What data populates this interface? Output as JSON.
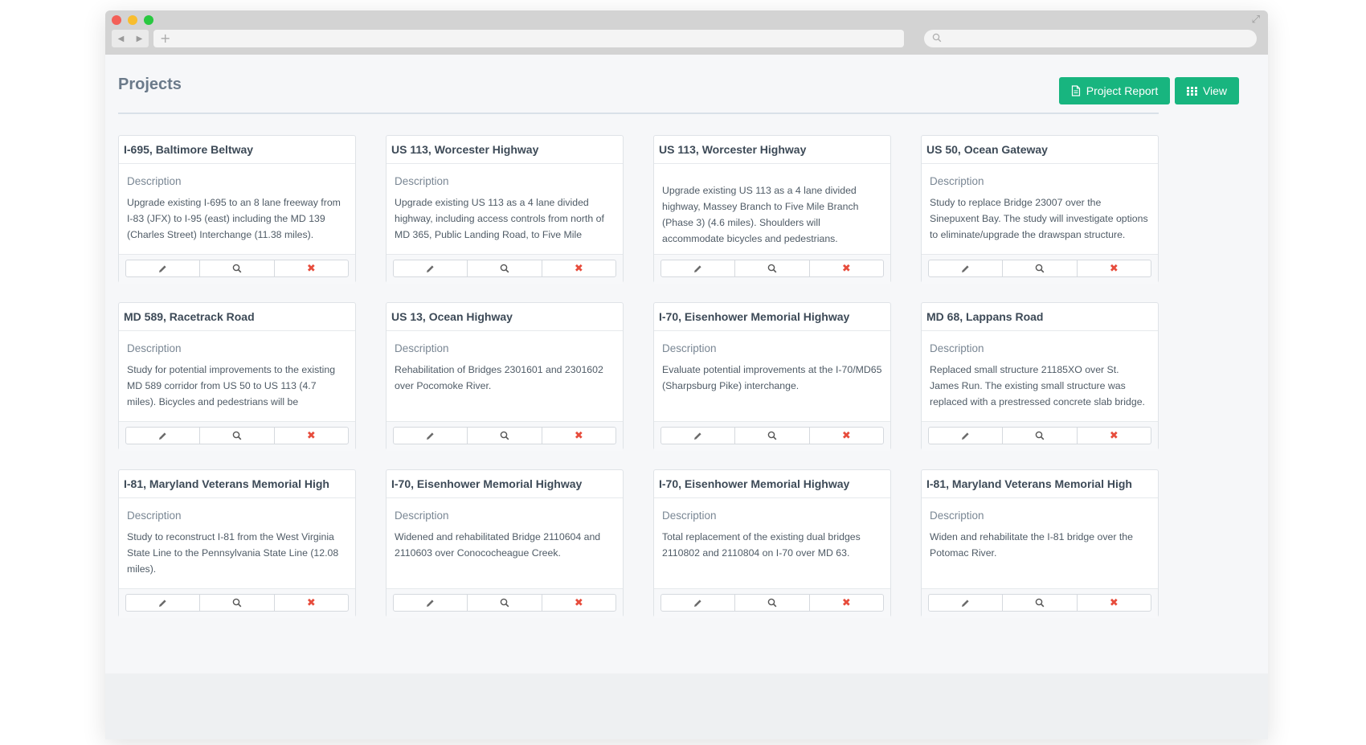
{
  "page": {
    "title": "Projects",
    "buttons": {
      "report_label": "Project Report",
      "view_label": "View"
    }
  },
  "icons": {
    "edit": "pencil-icon",
    "view": "search-icon",
    "delete": "close-icon"
  },
  "colors": {
    "accent": "#18b57f",
    "danger": "#e74c3c"
  },
  "projects": [
    {
      "title": "I-695, Baltimore Beltway",
      "label": "Description",
      "description": "Upgrade existing I-695 to an 8 lane freeway from I-83 (JFX) to I-95 (east) including the MD 139 (Charles Street) Interchange (11.38 miles)."
    },
    {
      "title": "US 113, Worcester Highway",
      "label": "Description",
      "description": "Upgrade existing US 113 as a 4 lane divided highway, including access controls from north of MD 365, Public Landing Road, to Five Mile"
    },
    {
      "title": "US 113, Worcester Highway",
      "label": "",
      "description": "Upgrade existing US 113 as a 4 lane divided highway, Massey Branch to Five Mile Branch (Phase 3) (4.6 miles). Shoulders will accommodate bicycles and pedestrians."
    },
    {
      "title": "US 50, Ocean Gateway",
      "label": "Description",
      "description": "Study to replace Bridge 23007 over the Sinepuxent Bay. The study will investigate options to eliminate/upgrade the drawspan structure."
    },
    {
      "title": "MD 589, Racetrack Road",
      "label": "Description",
      "description": "Study for potential improvements to the existing MD 589 corridor from US 50 to US 113 (4.7 miles). Bicycles and pedestrians will be"
    },
    {
      "title": "US 13, Ocean Highway",
      "label": "Description",
      "description": "Rehabilitation of Bridges 2301601 and 2301602 over Pocomoke River."
    },
    {
      "title": "I-70, Eisenhower Memorial Highway",
      "label": "Description",
      "description": "Evaluate potential improvements at the I-70/MD65 (Sharpsburg Pike) interchange."
    },
    {
      "title": "MD 68, Lappans Road",
      "label": "Description",
      "description": "Replaced small structure 21185XO over St. James Run. The existing small structure was replaced with a prestressed concrete slab bridge."
    },
    {
      "title": "I-81, Maryland Veterans Memorial High",
      "label": "Description",
      "description": "Study to reconstruct I-81 from the West Virginia State Line to the Pennsylvania State Line (12.08 miles)."
    },
    {
      "title": "I-70, Eisenhower Memorial Highway",
      "label": "Description",
      "description": "Widened and rehabilitated Bridge 2110604 and 2110603 over Conococheague Creek."
    },
    {
      "title": "I-70, Eisenhower Memorial Highway",
      "label": "Description",
      "description": "Total replacement of the existing dual bridges 2110802 and 2110804 on I-70 over MD 63."
    },
    {
      "title": "I-81, Maryland Veterans Memorial High",
      "label": "Description",
      "description": "Widen and rehabilitate the I-81 bridge over the Potomac River."
    }
  ]
}
